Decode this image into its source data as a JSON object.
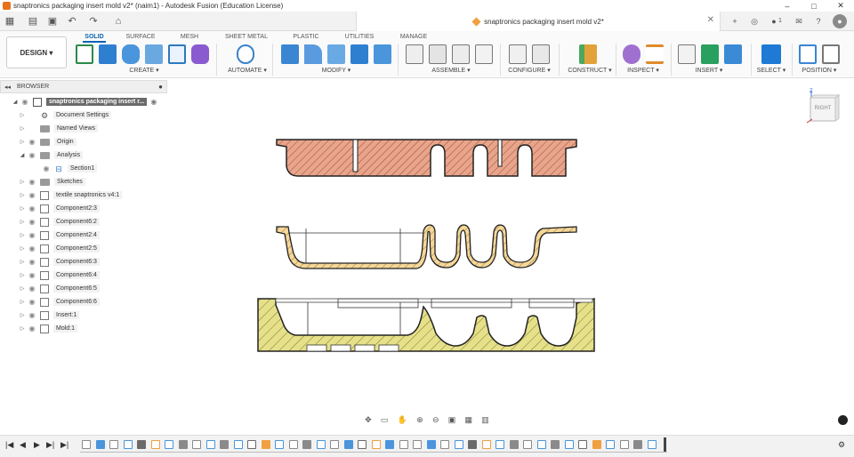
{
  "window": {
    "title": "snaptronics packaging insert mold v2* (naim1) - Autodesk Fusion (Education License)",
    "minimize": "–",
    "maximize": "□",
    "close": "✕"
  },
  "doc_tab": {
    "label": "snaptronics packaging insert mold v2*",
    "close": "✕"
  },
  "header_right": {
    "plus": "+",
    "job_count": "1"
  },
  "design_button": "DESIGN ▾",
  "ribbon_tabs": [
    {
      "label": "SOLID",
      "active": true
    },
    {
      "label": "SURFACE"
    },
    {
      "label": "MESH"
    },
    {
      "label": "SHEET METAL"
    },
    {
      "label": "PLASTIC"
    },
    {
      "label": "UTILITIES"
    },
    {
      "label": "MANAGE"
    }
  ],
  "ribbon_groups": [
    "CREATE ▾",
    "AUTOMATE ▾",
    "MODIFY ▾",
    "ASSEMBLE ▾",
    "CONFIGURE ▾",
    "CONSTRUCT ▾",
    "INSPECT ▾",
    "INSERT ▾",
    "SELECT ▾",
    "POSITION ▾"
  ],
  "browser": {
    "title": "BROWSER",
    "root": "snaptronics packaging insert r...",
    "items": [
      {
        "label": "Document Settings",
        "icon": "gear-icon"
      },
      {
        "label": "Named Views",
        "icon": "folder-icon"
      },
      {
        "label": "Origin",
        "icon": "folder-icon"
      },
      {
        "label": "Analysis",
        "icon": "folder-icon",
        "expanded": true
      },
      {
        "label": "Section1",
        "icon": "section-analysis-icon",
        "child": true
      },
      {
        "label": "Sketches",
        "icon": "folder-icon"
      },
      {
        "label": "textile snaptronics v4:1",
        "icon": "linked-component-icon"
      },
      {
        "label": "Component2:3",
        "icon": "component-icon"
      },
      {
        "label": "Component6:2",
        "icon": "component-icon"
      },
      {
        "label": "Component2:4",
        "icon": "component-icon"
      },
      {
        "label": "Component2:5",
        "icon": "component-icon"
      },
      {
        "label": "Component6:3",
        "icon": "component-icon"
      },
      {
        "label": "Component6:4",
        "icon": "component-icon"
      },
      {
        "label": "Component6:5",
        "icon": "component-icon"
      },
      {
        "label": "Component6:6",
        "icon": "component-icon"
      },
      {
        "label": "Insert:1",
        "icon": "component-icon"
      },
      {
        "label": "Mold:1",
        "icon": "linked-component-icon"
      }
    ]
  },
  "viewcube": {
    "face": "RIGHT",
    "axis_label": "Z"
  },
  "colors": {
    "accent": "#0a64b4",
    "section_top": "#e8a58c",
    "section_mid": "#f5d79a",
    "section_mold": "#e6e08a"
  }
}
